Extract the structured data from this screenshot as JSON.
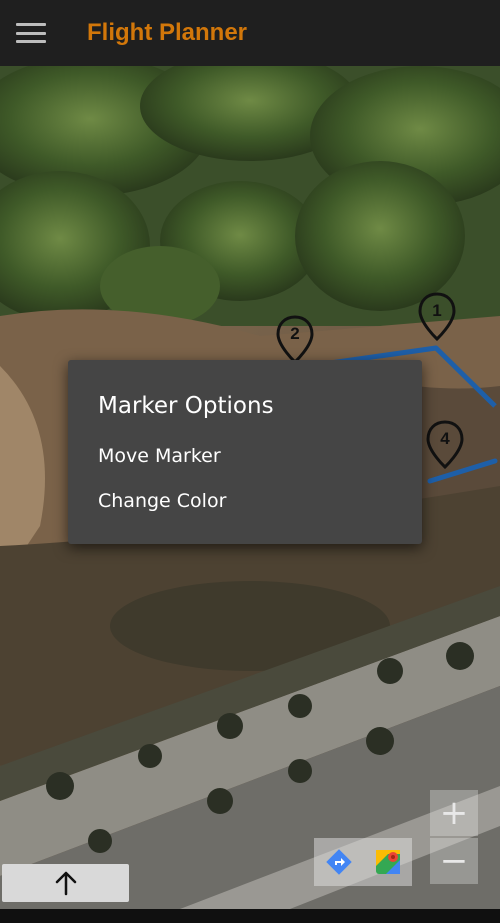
{
  "app": {
    "title": "Flight Planner",
    "menu_icon": "hamburger-menu-icon",
    "accent_color": "#d2770a",
    "appbar_color": "#1f1f1f"
  },
  "map": {
    "view": "satellite",
    "route_color": "#1e5fa8",
    "markers": [
      {
        "label": "1"
      },
      {
        "label": "2"
      },
      {
        "label": "4"
      }
    ]
  },
  "dialog": {
    "title": "Marker Options",
    "items": [
      {
        "label": "Move Marker"
      },
      {
        "label": "Change Color"
      }
    ]
  },
  "controls": {
    "zoom_in": "+",
    "zoom_out": "−",
    "directions_icon": "directions-icon",
    "google_maps_icon": "google-maps-icon",
    "up_icon": "arrow-up-icon"
  }
}
